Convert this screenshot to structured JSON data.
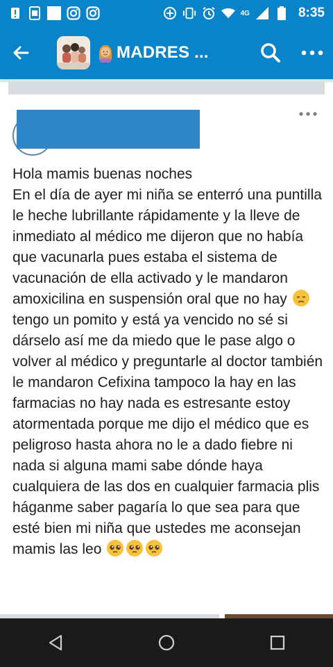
{
  "status_bar": {
    "time": "8:35",
    "network": "4G",
    "icons_left": [
      "alert-icon",
      "screenshot-icon",
      "image-icon",
      "instagram-icon",
      "instagram-icon"
    ],
    "icons_right": [
      "data-saver-icon",
      "vibrate-icon",
      "alarm-icon",
      "wifi-icon",
      "signal-icon",
      "battery-icon"
    ]
  },
  "app_bar": {
    "group_title": "MADRES ...",
    "title_emoji": "woman-emoji",
    "back_icon": "back-arrow-icon",
    "search_icon": "search-icon",
    "more_icon": "more-icon"
  },
  "post": {
    "menu_icon": "more-icon",
    "lines": [
      "Hola mamis buenas noches",
      "En el día de ayer mi niña se enterró una puntilla le heche lubrillante rápidamente y la lleve de inmediato al médico me dijeron que no había que vacunarla pues estaba el sistema de vacunación de ella activado y le mandaron amoxicilina en suspensión oral que no hay"
    ],
    "segment_after_emoji1": "tengo un pomito y está ya vencido no sé si dárselo así me da miedo que le pase algo o volver al médico y preguntarle al doctor también le mandaron Cefixina tampoco la hay en las farmacias no hay nada es estresante estoy atormentada porque me dijo el médico que es peligroso hasta ahora no le a dado fiebre ni nada si alguna mami sabe dónde haya cualquiera de las dos en cualquier farmacia plis háganme saber pagaría lo que sea para que esté bien mi niña que ustedes me aconsejan mamis las leo",
    "emoji1": "disappointed-face",
    "emoji_end": [
      "pleading-face",
      "pleading-face",
      "pleading-face"
    ]
  },
  "colors": {
    "brand": "#0a84c9",
    "redaction": "#2e86c9",
    "text": "#1c1e21",
    "nav": "#1a1a1a"
  },
  "nav_bar": {
    "icons": [
      "back-nav-icon",
      "home-nav-icon",
      "recents-nav-icon"
    ]
  }
}
